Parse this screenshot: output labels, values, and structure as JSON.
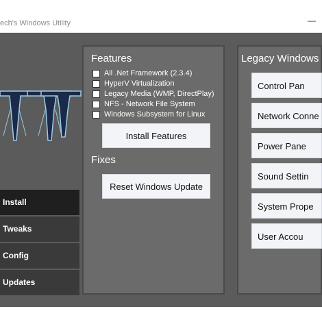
{
  "window": {
    "title": "ech's Windows Utility",
    "minimize_glyph": "—"
  },
  "nav": {
    "items": [
      {
        "label": "Install"
      },
      {
        "label": "Tweaks"
      },
      {
        "label": "Config"
      },
      {
        "label": "Updates"
      }
    ]
  },
  "features": {
    "heading": "Features",
    "options": [
      {
        "label": "All .Net Framework (2.3.4)",
        "checked": false
      },
      {
        "label": "HyperV Virtualization",
        "checked": false
      },
      {
        "label": "Legacy Media (WMP, DirectPlay)",
        "checked": false
      },
      {
        "label": "NFS - Network File System",
        "checked": false
      },
      {
        "label": "Windows Subsystem for Linux",
        "checked": false
      }
    ],
    "install_button": "Install Features"
  },
  "fixes": {
    "heading": "Fixes",
    "reset_button": "Reset Windows Update"
  },
  "legacy": {
    "heading": "Legacy Windows",
    "buttons": [
      {
        "label": "Control Pan"
      },
      {
        "label": "Network Conne"
      },
      {
        "label": "Power Pane"
      },
      {
        "label": "Sound Settin"
      },
      {
        "label": "System Prope"
      },
      {
        "label": "User Accou"
      }
    ]
  },
  "colors": {
    "panel": "#6b6b6b",
    "background": "#5b5b5b",
    "nav_active": "#1f1f1f",
    "nav": "#3a3a3a",
    "logo": "#9ccbe6"
  }
}
